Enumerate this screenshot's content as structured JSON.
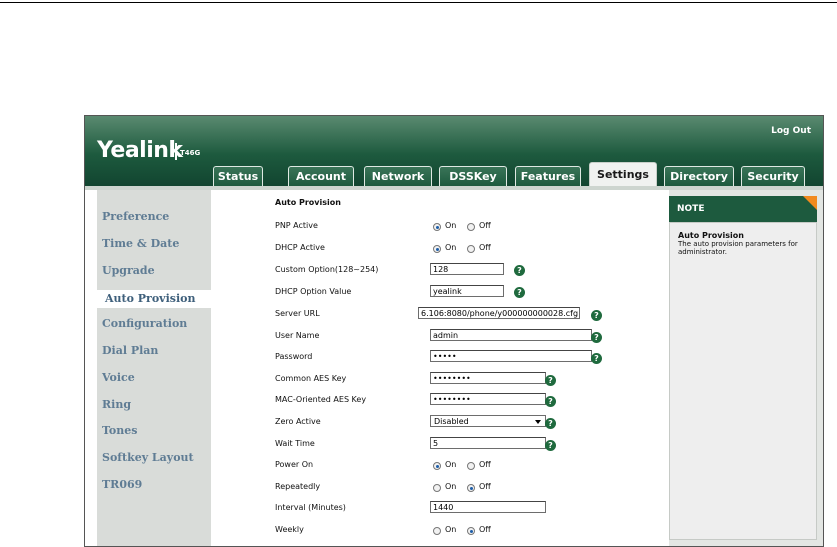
{
  "header": {
    "logo": "Yealink",
    "model": "T46G",
    "logout": "Log Out"
  },
  "tabs": [
    "Status",
    "Account",
    "Network",
    "DSSKey",
    "Features",
    "Settings",
    "Directory",
    "Security"
  ],
  "sidebar": {
    "items": [
      "Preference",
      "Time & Date",
      "Upgrade",
      "Auto Provision",
      "Configuration",
      "Dial Plan",
      "Voice",
      "Ring",
      "Tones",
      "Softkey Layout",
      "TR069"
    ]
  },
  "form": {
    "title": "Auto Provision",
    "pnp_active": {
      "label": "PNP Active",
      "on": "On",
      "off": "Off"
    },
    "dhcp_active": {
      "label": "DHCP Active",
      "on": "On",
      "off": "Off"
    },
    "custom_option": {
      "label": "Custom Option(128~254)",
      "value": "128"
    },
    "dhcp_option_value": {
      "label": "DHCP Option Value",
      "value": "yealink"
    },
    "server_url": {
      "label": "Server URL",
      "value": "6.106:8080/phone/y000000000028.cfg"
    },
    "user_name": {
      "label": "User Name",
      "value": "admin"
    },
    "password": {
      "label": "Password",
      "value": "•••••"
    },
    "common_aes_key": {
      "label": "Common AES Key",
      "value": "••••••••"
    },
    "mac_aes_key": {
      "label": "MAC-Oriented AES Key",
      "value": "••••••••"
    },
    "zero_active": {
      "label": "Zero Active",
      "value": "Disabled"
    },
    "wait_time": {
      "label": "Wait Time",
      "value": "5"
    },
    "power_on": {
      "label": "Power On",
      "on": "On",
      "off": "Off"
    },
    "repeatedly": {
      "label": "Repeatedly",
      "on": "On",
      "off": "Off"
    },
    "interval": {
      "label": "Interval (Minutes)",
      "value": "1440"
    },
    "weekly": {
      "label": "Weekly",
      "on": "On",
      "off": "Off"
    }
  },
  "note": {
    "header": "NOTE",
    "title": "Auto Provision",
    "text": "The auto provision parameters for administrator."
  },
  "colors": {
    "header_green": "#1d5a3e",
    "note_accent": "#f28a1e",
    "sidebar_text": "#5f7c94"
  }
}
